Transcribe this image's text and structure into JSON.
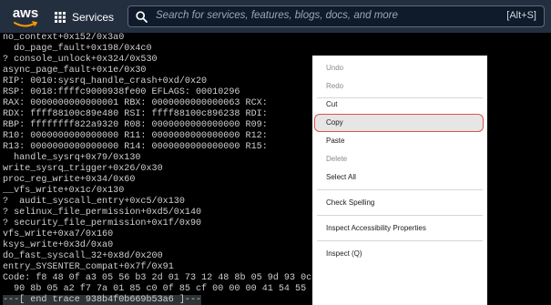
{
  "topbar": {
    "logo_text": "aws",
    "services_label": "Services",
    "search_placeholder": "Search for services, features, blogs, docs, and more",
    "search_shortcut": "[Alt+S]"
  },
  "terminal": {
    "lines": [
      "no_context+0x152/0x3a0",
      "  do_page_fault+0x198/0x4c0",
      "? console_unlock+0x324/0x530",
      "async_page_fault+0x1e/0x30",
      "RIP: 0010:sysrq_handle_crash+0xd/0x20",
      "RSP: 0018:ffffc9000938fe00 EFLAGS: 00010296",
      "RAX: 0000000000000001 RBX: 0000000000000063 RCX:",
      "RDX: ffff88100c89e480 RSI: ffff88100c896238 RDI:",
      "RBP: ffffffff822a9320 R08: 0000000000000000 R09:",
      "R10: 0000000000000000 R11: 0000000000000000 R12:",
      "R13: 0000000000000000 R14: 0000000000000000 R15:",
      "  handle_sysrq+0x79/0x130",
      "write_sysrq_trigger+0x26/0x30",
      "proc_reg_write+0x34/0x60",
      "__vfs_write+0x1c/0x130",
      "?  audit_syscall_entry+0xc5/0x130",
      "? selinux_file_permission+0xd5/0x140",
      "? security_file_permission+0x1f/0x90",
      "vfs_write+0xa7/0x160",
      "ksys_write+0x3d/0xa0",
      "do_fast_syscall_32+0x8d/0x200",
      "entry_SYSENTER_compat+0x7f/0x91",
      "Code: f8 48 0f a3 05 56 b3 2d 01 73 12 48 8b 05 9d 93 0c 01 be fd 00 00 00 48 8b 40 30",
      "  90 8b 05 a2 f7 7a 01 85 c0 0f 85 cf 00 00 00 41 54 55",
      "---[ end trace 938b4f0b669b53a6 ]---"
    ]
  },
  "context_menu": {
    "items": [
      {
        "label": "Undo",
        "enabled": false
      },
      {
        "label": "Redo",
        "enabled": false
      },
      {
        "label": "Cut",
        "enabled": true
      },
      {
        "label": "Copy",
        "enabled": true,
        "highlighted": true
      },
      {
        "label": "Paste",
        "enabled": true
      },
      {
        "label": "Delete",
        "enabled": false
      },
      {
        "label": "Select All",
        "enabled": true
      },
      {
        "label": "Check Spelling",
        "enabled": true
      },
      {
        "label": "Inspect Accessibility Properties",
        "enabled": true
      },
      {
        "label": "Inspect (Q)",
        "enabled": true
      }
    ]
  },
  "colors": {
    "aws_orange": "#ff9900",
    "topbar_bg": "#232f3e",
    "copy_outline": "#d9534f"
  },
  "icons": [
    "aws-smile-icon",
    "services-grid-icon",
    "search-icon"
  ]
}
